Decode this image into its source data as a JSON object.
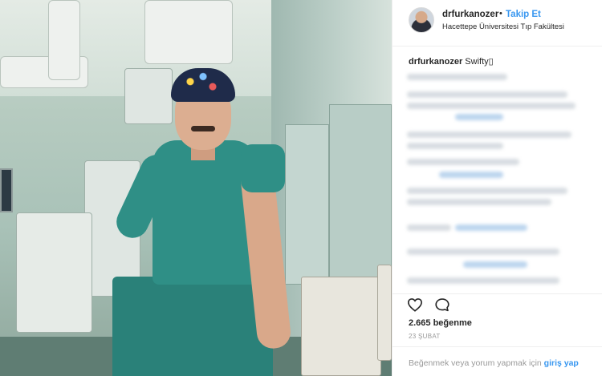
{
  "post": {
    "author": "drfurkanozer",
    "separator": "•",
    "follow_label": "Takip Et",
    "location": "Hacettepe Üniversitesi Tıp Fakültesi",
    "caption_user": "drfurkanozer",
    "caption_text": " Swifty▯",
    "likes": "2.665 beğenme",
    "date": "23 ŞUBAT",
    "login_prompt": "Beğenmek veya yorum yapmak için ",
    "login_link": "giriş yap"
  },
  "icons": {
    "like": "heart-icon",
    "comment": "comment-icon",
    "avatar": "avatar"
  },
  "colors": {
    "link": "#3897f0",
    "text": "#262626",
    "muted": "#999999",
    "scrubs": "#2f8f86"
  }
}
